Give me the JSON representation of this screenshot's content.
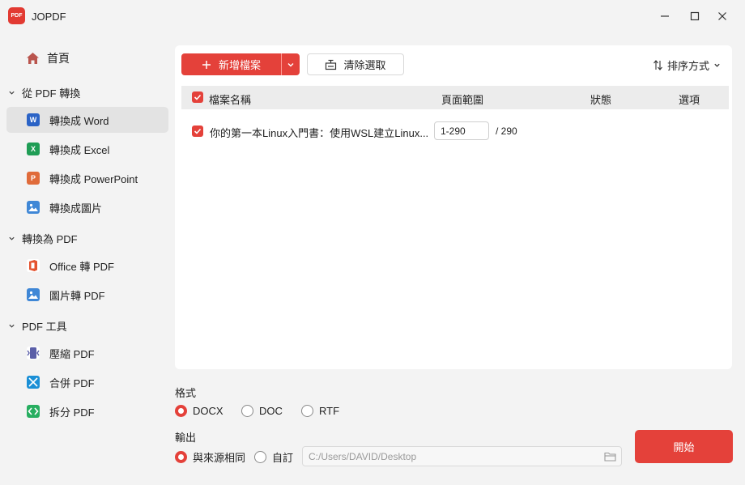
{
  "window": {
    "title": "JOPDF",
    "logo_text": "PDF",
    "accent": "#e4413a",
    "controls": [
      "minimize-icon",
      "maximize-icon",
      "close-icon"
    ]
  },
  "sidebar": {
    "home": {
      "label": "首頁",
      "icon": "home-icon"
    },
    "groups": [
      {
        "label": "從 PDF 轉換",
        "items": [
          {
            "label": "轉換成 Word",
            "icon": "word-icon",
            "badge": "W",
            "color": "#2b63c6",
            "active": true
          },
          {
            "label": "轉換成 Excel",
            "icon": "excel-icon",
            "badge": "X",
            "color": "#1f9d55"
          },
          {
            "label": "轉換成 PowerPoint",
            "icon": "powerpoint-icon",
            "badge": "P",
            "color": "#e06b3a"
          },
          {
            "label": "轉換成圖片",
            "icon": "image-icon",
            "color": "#3f87d6"
          }
        ]
      },
      {
        "label": "轉換為 PDF",
        "items": [
          {
            "label": "Office 轉 PDF",
            "icon": "office-icon",
            "color": "#e4532f"
          },
          {
            "label": "圖片轉 PDF",
            "icon": "image-to-pdf-icon",
            "color": "#3f87d6"
          }
        ]
      },
      {
        "label": "PDF 工具",
        "items": [
          {
            "label": "壓縮 PDF",
            "icon": "compress-icon",
            "color": "#5b5fa8"
          },
          {
            "label": "合併 PDF",
            "icon": "merge-icon",
            "color": "#1a8fd6"
          },
          {
            "label": "拆分 PDF",
            "icon": "split-icon",
            "color": "#27ae60"
          }
        ]
      }
    ]
  },
  "toolbar": {
    "add_label": "新增檔案",
    "clear_label": "清除選取",
    "sort_label": "排序方式"
  },
  "table": {
    "headers": {
      "name": "檔案名稱",
      "range": "頁面範圍",
      "status": "狀態",
      "options": "選項"
    },
    "rows": [
      {
        "checked": true,
        "name": "你的第一本Linux入門書：使用WSL建立Linux...",
        "range": "1-290",
        "total": "/ 290",
        "status": "",
        "options": ""
      }
    ]
  },
  "format": {
    "label": "格式",
    "options": [
      "DOCX",
      "DOC",
      "RTF"
    ],
    "selected": "DOCX"
  },
  "output": {
    "label": "輸出",
    "options": [
      "與來源相同",
      "自訂"
    ],
    "selected": "與來源相同",
    "path": "C:/Users/DAVID/Desktop"
  },
  "start_label": "開始"
}
